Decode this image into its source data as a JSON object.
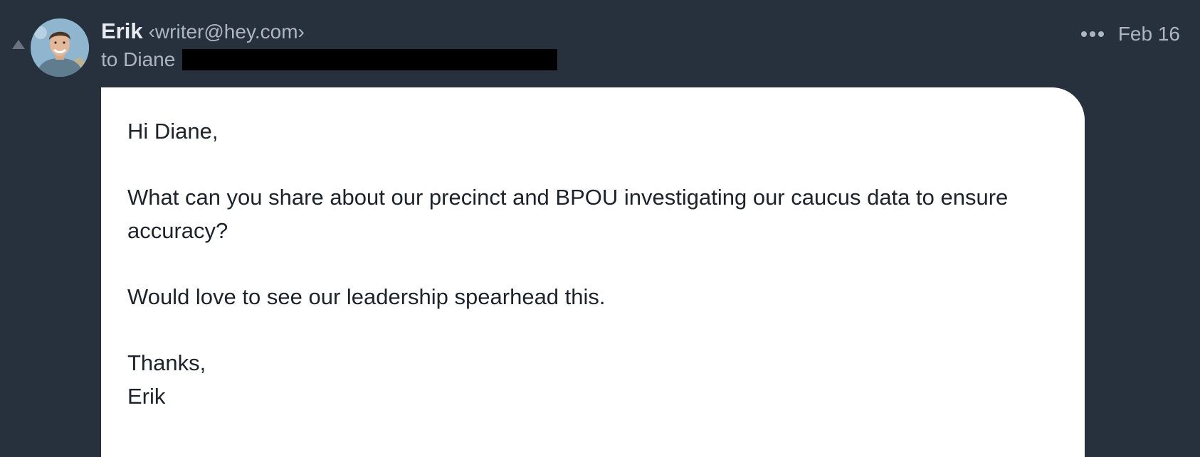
{
  "message": {
    "sender": {
      "name": "Erik",
      "email": "‹writer@hey.com›"
    },
    "recipient_label": "to Diane",
    "date": "Feb 16",
    "more_icon": "more-horizontal-icon",
    "body": {
      "greeting": "Hi Diane,",
      "paragraph1": "What can you share about our precinct and BPOU investigating our caucus data to ensure accuracy?",
      "paragraph2": "Would love to see our leadership spearhead this.",
      "closing": "Thanks,",
      "signature": "Erik"
    }
  },
  "colors": {
    "background": "#27303d",
    "card": "#ffffff",
    "sender_name": "#e8ebef",
    "muted_text": "#aeb5bf",
    "body_text": "#1d232b",
    "redaction": "#000000"
  }
}
